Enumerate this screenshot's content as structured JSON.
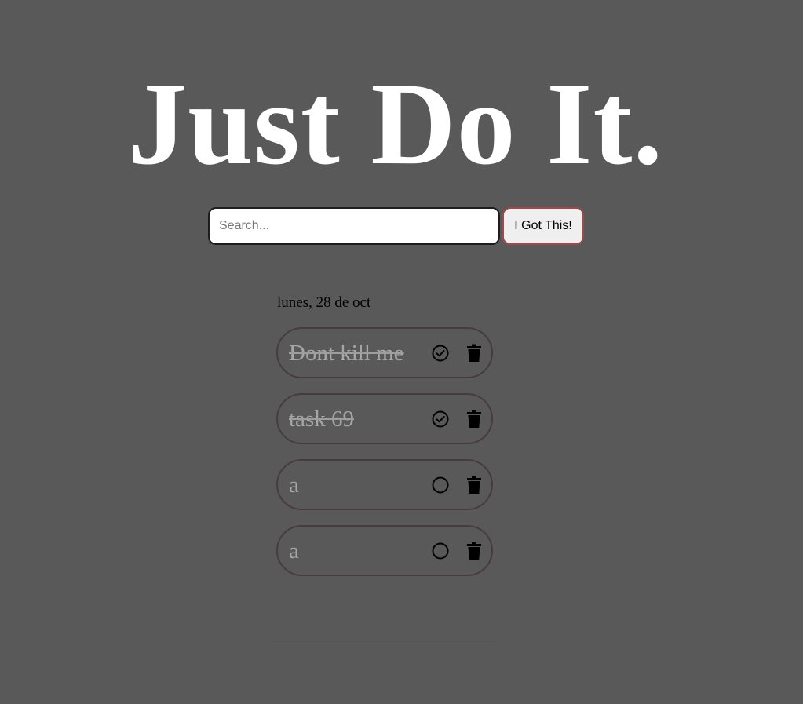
{
  "header": {
    "title": "Just Do It."
  },
  "search": {
    "placeholder": "Search...",
    "value": "",
    "button_label": "I Got This!"
  },
  "date_label": "lunes, 28 de oct",
  "tasks": [
    {
      "text": "Dont kill me",
      "completed": true,
      "check_icon": "check-circle-icon",
      "delete_icon": "trash-icon"
    },
    {
      "text": "task 69",
      "completed": true,
      "check_icon": "check-circle-icon",
      "delete_icon": "trash-icon"
    },
    {
      "text": "a",
      "completed": false,
      "check_icon": "empty-circle-icon",
      "delete_icon": "trash-icon"
    },
    {
      "text": "a",
      "completed": false,
      "check_icon": "empty-circle-icon",
      "delete_icon": "trash-icon"
    }
  ],
  "colors": {
    "background": "#595959",
    "title": "#ffffff",
    "task_border": "#463c3f",
    "task_text": "#a6a6a6",
    "button_border": "#a14848",
    "button_bg": "#efefef"
  }
}
